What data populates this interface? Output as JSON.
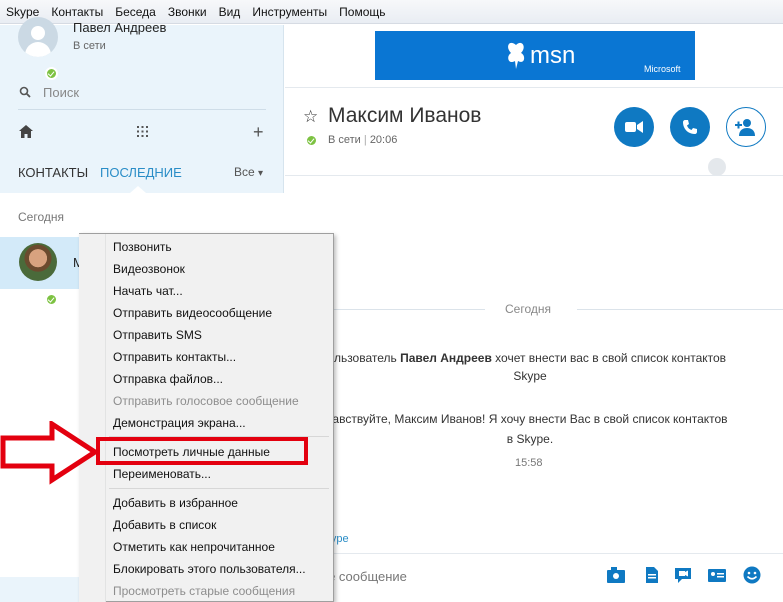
{
  "menubar": [
    "Skype",
    "Контакты",
    "Беседа",
    "Звонки",
    "Вид",
    "Инструменты",
    "Помощь"
  ],
  "profile": {
    "name": "Павел Андреев",
    "status": "В сети"
  },
  "search": {
    "placeholder": "Поиск"
  },
  "tabs": {
    "contacts": "КОНТАКТЫ",
    "recent": "ПОСЛЕДНИЕ",
    "filter": "Все"
  },
  "recent": {
    "today": "Сегодня",
    "contact_initial": "М"
  },
  "banner": {
    "brand": "msn",
    "vendor": "Microsoft"
  },
  "conversation": {
    "name": "Максим Иванов",
    "status": "В сети",
    "time": "20:06",
    "today": "Сегодня",
    "msg1_prefix": "льзователь ",
    "msg1_bold": "Павел Андреев",
    "msg1_suffix": " хочет внести вас в свой список контактов",
    "msg1_line2": "Skype",
    "msg2_line1": "авствуйте, Максим Иванов! Я хочу внести Вас в свой список контактов",
    "msg2_line2": "в Skype.",
    "msg_time": "15:58",
    "skype_link": "Skype",
    "compose_placeholder": "ите сообщение"
  },
  "context_menu": {
    "items": [
      {
        "label": "Позвонить",
        "disabled": false
      },
      {
        "label": "Видеозвонок",
        "disabled": false
      },
      {
        "label": "Начать чат...",
        "disabled": false
      },
      {
        "label": "Отправить видеосообщение",
        "disabled": false
      },
      {
        "label": "Отправить SMS",
        "disabled": false
      },
      {
        "label": "Отправить контакты...",
        "disabled": false
      },
      {
        "label": "Отправка файлов...",
        "disabled": false
      },
      {
        "label": "Отправить голосовое сообщение",
        "disabled": true
      },
      {
        "label": "Демонстрация экрана...",
        "disabled": false
      },
      {
        "label": "Посмотреть личные данные",
        "disabled": false,
        "highlighted": true
      },
      {
        "label": "Переименовать...",
        "disabled": false
      },
      {
        "label": "Добавить в избранное",
        "disabled": false
      },
      {
        "label": "Добавить в список",
        "disabled": false
      },
      {
        "label": "Отметить как непрочитанное",
        "disabled": false
      },
      {
        "label": "Блокировать этого пользователя...",
        "disabled": false
      },
      {
        "label": "Просмотреть старые сообщения",
        "disabled": true
      }
    ]
  },
  "colors": {
    "accent": "#0f79c2",
    "link": "#2a8dc7",
    "online": "#7dc242",
    "annotation": "#e3000f",
    "banner": "#0a76d3"
  }
}
